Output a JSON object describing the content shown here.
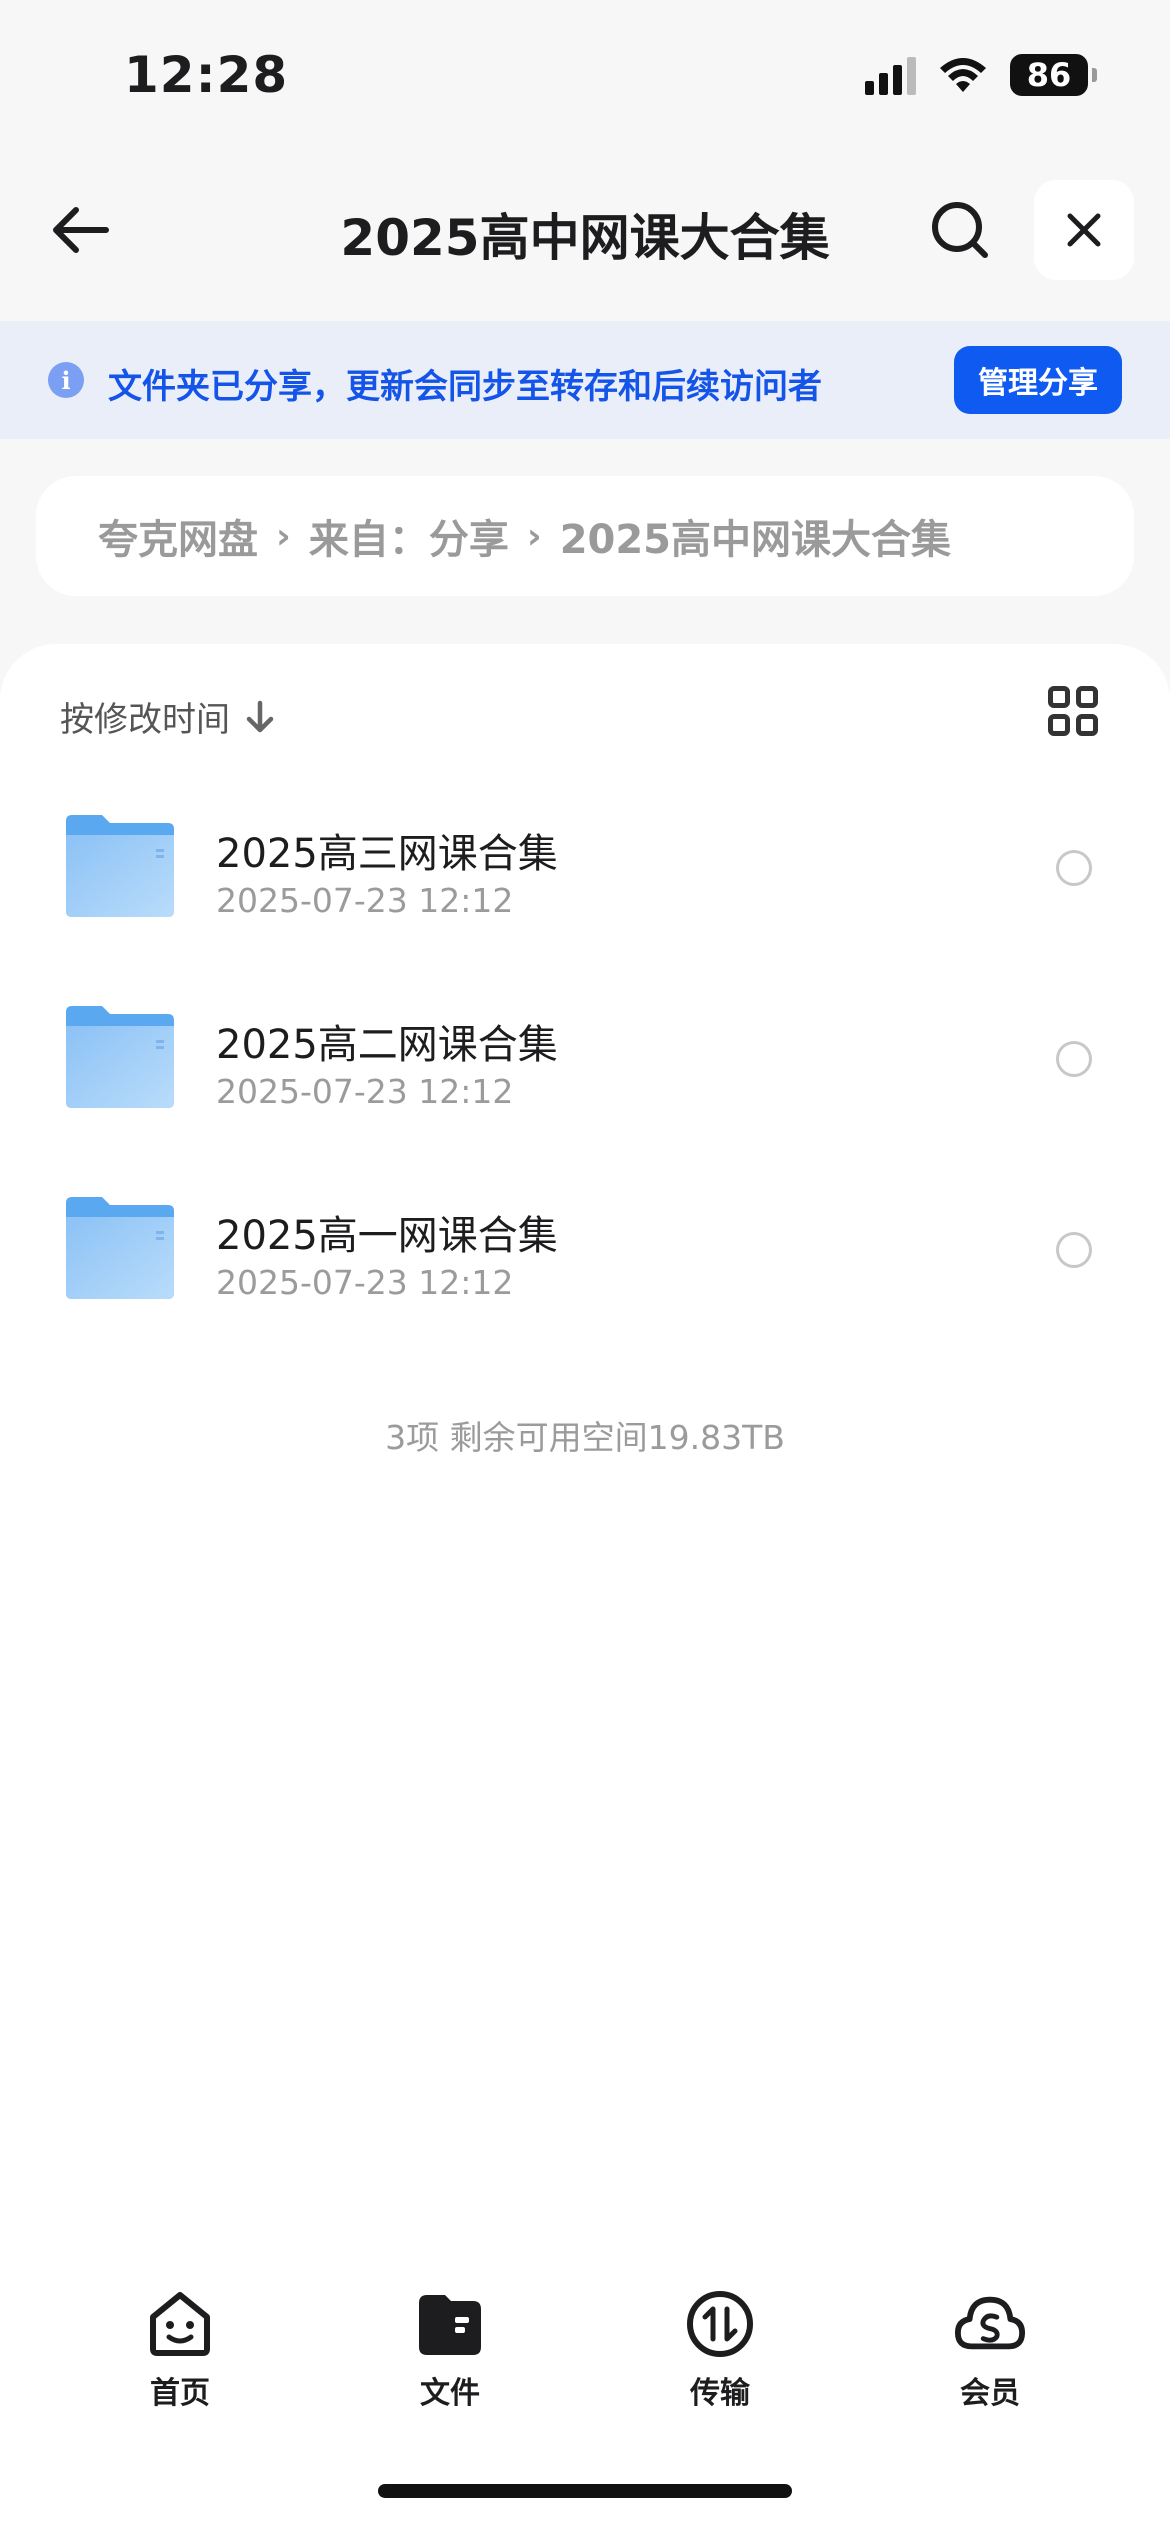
{
  "status_bar": {
    "time": "12:28",
    "battery": "86"
  },
  "nav": {
    "title": "2025高中网课大合集"
  },
  "share_banner": {
    "text": "文件夹已分享，更新会同步至转存和后续访问者",
    "manage_label": "管理分享"
  },
  "breadcrumb": {
    "items": [
      "夸克网盘",
      "来自：分享",
      "2025高中网课大合集"
    ]
  },
  "toolbar": {
    "sort_label": "按修改时间"
  },
  "files": [
    {
      "name": "2025高三网课合集",
      "date": "2025-07-23 12:12"
    },
    {
      "name": "2025高二网课合集",
      "date": "2025-07-23 12:12"
    },
    {
      "name": "2025高一网课合集",
      "date": "2025-07-23 12:12"
    }
  ],
  "summary": "3项 剩余可用空间19.83TB",
  "tabbar": {
    "items": [
      {
        "label": "首页",
        "icon": "home-face-icon"
      },
      {
        "label": "文件",
        "icon": "folder-icon",
        "active": true
      },
      {
        "label": "传输",
        "icon": "transfer-icon"
      },
      {
        "label": "会员",
        "icon": "member-cloud-icon"
      }
    ]
  },
  "colors": {
    "accent": "#0f5af0",
    "banner_bg": "#e9eef9",
    "banner_text": "#1454e8",
    "folder": "#5aa8f0"
  }
}
